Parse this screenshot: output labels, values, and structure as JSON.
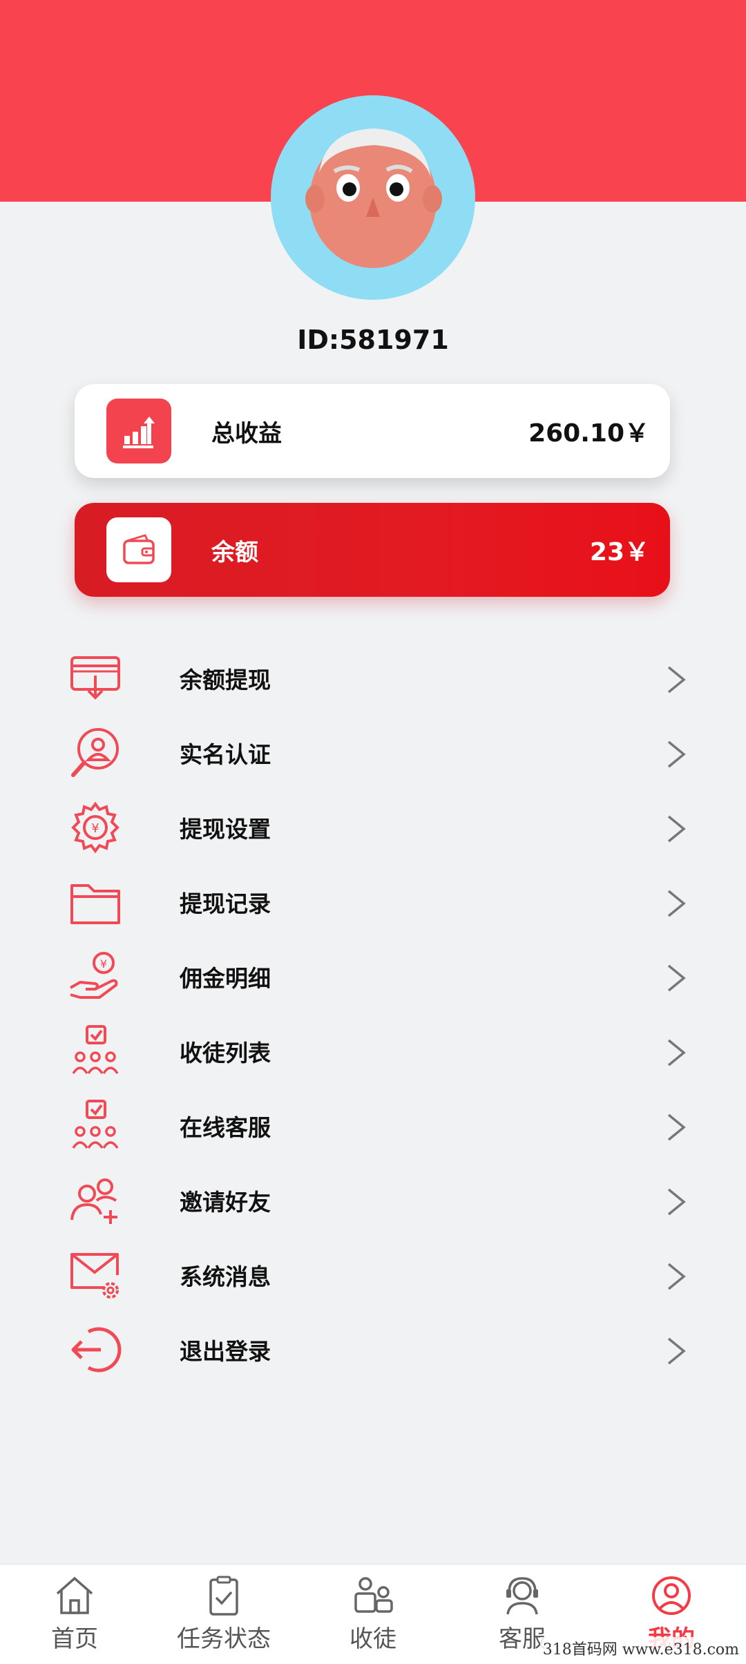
{
  "profile": {
    "id_text": "ID:581971"
  },
  "cards": {
    "total": {
      "label": "总收益",
      "value": "260.10￥",
      "icon": "bar-chart-up-icon"
    },
    "balance": {
      "label": "余额",
      "value": "23￥",
      "icon": "wallet-icon"
    }
  },
  "menu": {
    "items": [
      {
        "label": "余额提现",
        "icon": "withdraw-card-icon"
      },
      {
        "label": "实名认证",
        "icon": "user-search-icon"
      },
      {
        "label": "提现设置",
        "icon": "settings-gear-yen-icon"
      },
      {
        "label": "提现记录",
        "icon": "folder-icon"
      },
      {
        "label": "佣金明细",
        "icon": "hand-coin-icon"
      },
      {
        "label": "收徒列表",
        "icon": "team-check-icon"
      },
      {
        "label": "在线客服",
        "icon": "team-check-icon"
      },
      {
        "label": "邀请好友",
        "icon": "add-user-icon"
      },
      {
        "label": "系统消息",
        "icon": "mail-settings-icon"
      },
      {
        "label": "退出登录",
        "icon": "logout-icon"
      }
    ]
  },
  "tabbar": {
    "items": [
      {
        "label": "首页",
        "icon": "home-icon",
        "active": false
      },
      {
        "label": "任务状态",
        "icon": "clipboard-check-icon",
        "active": false
      },
      {
        "label": "收徒",
        "icon": "users-icon",
        "active": false
      },
      {
        "label": "客服",
        "icon": "headset-agent-icon",
        "active": false
      },
      {
        "label": "我的",
        "icon": "user-circle-icon",
        "active": true
      }
    ]
  },
  "watermark": "318首码网 www.e318.com",
  "colors": {
    "brand_red": "#f9434f",
    "balance_red": "#e31a22",
    "active_tab": "#f33a45",
    "icon_red": "#ef4a55"
  }
}
